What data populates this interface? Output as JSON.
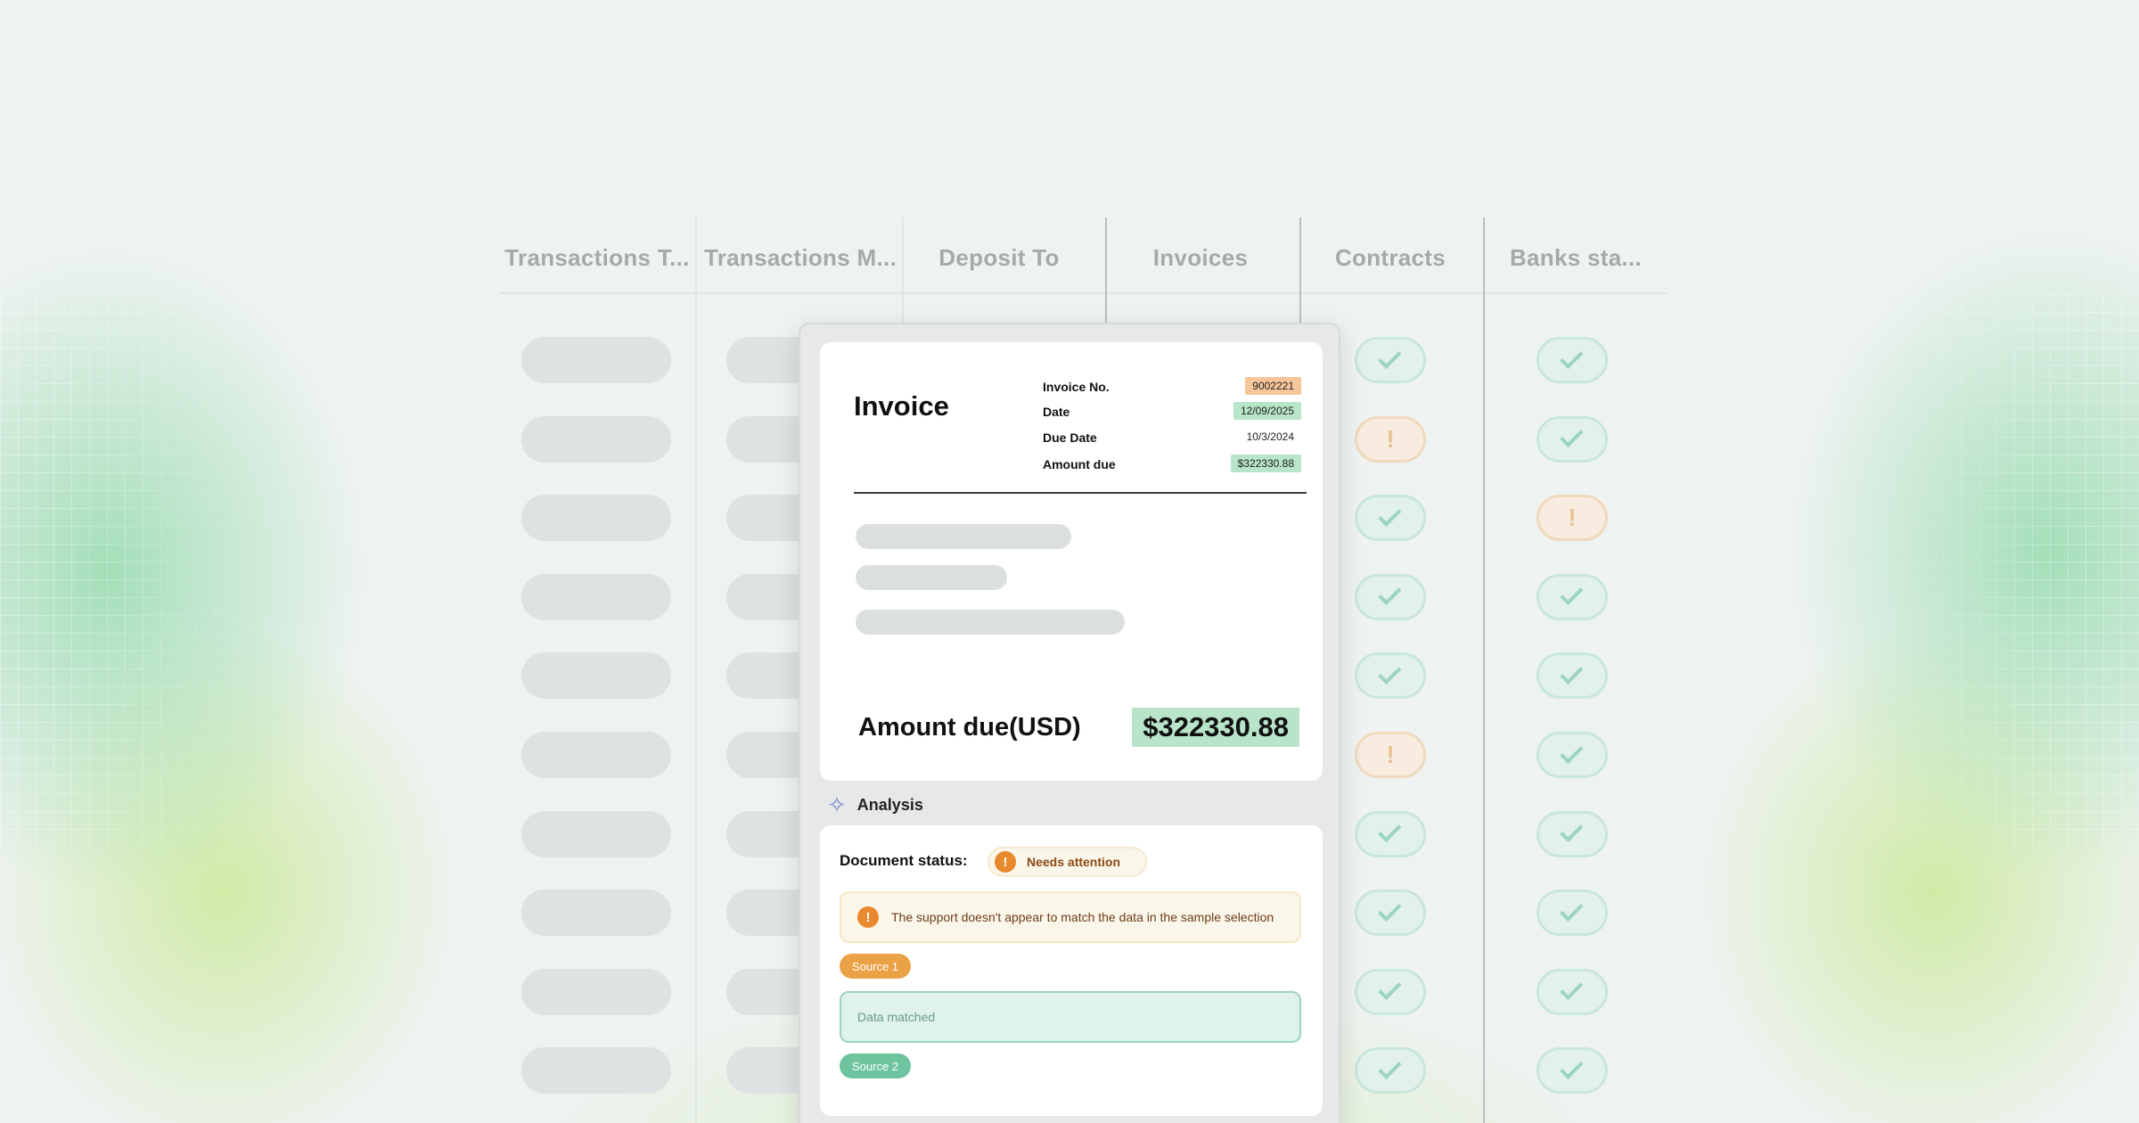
{
  "table": {
    "columns": [
      "Transactions T...",
      "Transactions M...",
      "Deposit To",
      "Invoices",
      "Contracts",
      "Banks sta..."
    ],
    "contracts_status": [
      "ok",
      "warn",
      "ok",
      "ok",
      "ok",
      "warn",
      "ok",
      "ok",
      "ok",
      "ok"
    ],
    "banks_status": [
      "ok",
      "ok",
      "warn",
      "ok",
      "ok",
      "ok",
      "ok",
      "ok",
      "ok",
      "ok"
    ]
  },
  "invoice": {
    "title": "Invoice",
    "fields": [
      {
        "label": "Invoice No.",
        "value": "9002221",
        "highlight": "#f6c69a"
      },
      {
        "label": "Date",
        "value": "12/09/2025",
        "highlight": "#b8e4c9"
      },
      {
        "label": "Due Date",
        "value": "10/3/2024",
        "highlight": "none"
      },
      {
        "label": "Amount due",
        "value": "$322330.88",
        "highlight": "#b8e4c9"
      }
    ],
    "amount_label": "Amount due(USD)",
    "amount_value": "$322330.88"
  },
  "analysis": {
    "header": "Analysis",
    "icon": "sparkle-icon",
    "doc_status_label": "Document status:",
    "status_badge": "Needs attention",
    "alert_text": "The support doesn't appear to match the data in the sample selection",
    "source1": "Source 1",
    "matched_text": "Data matched",
    "source2": "Source 2"
  },
  "colors": {
    "warn": "#e8892e",
    "ok": "#9cd4c0",
    "source1": "#eba145",
    "source2": "#6fc4a0"
  }
}
